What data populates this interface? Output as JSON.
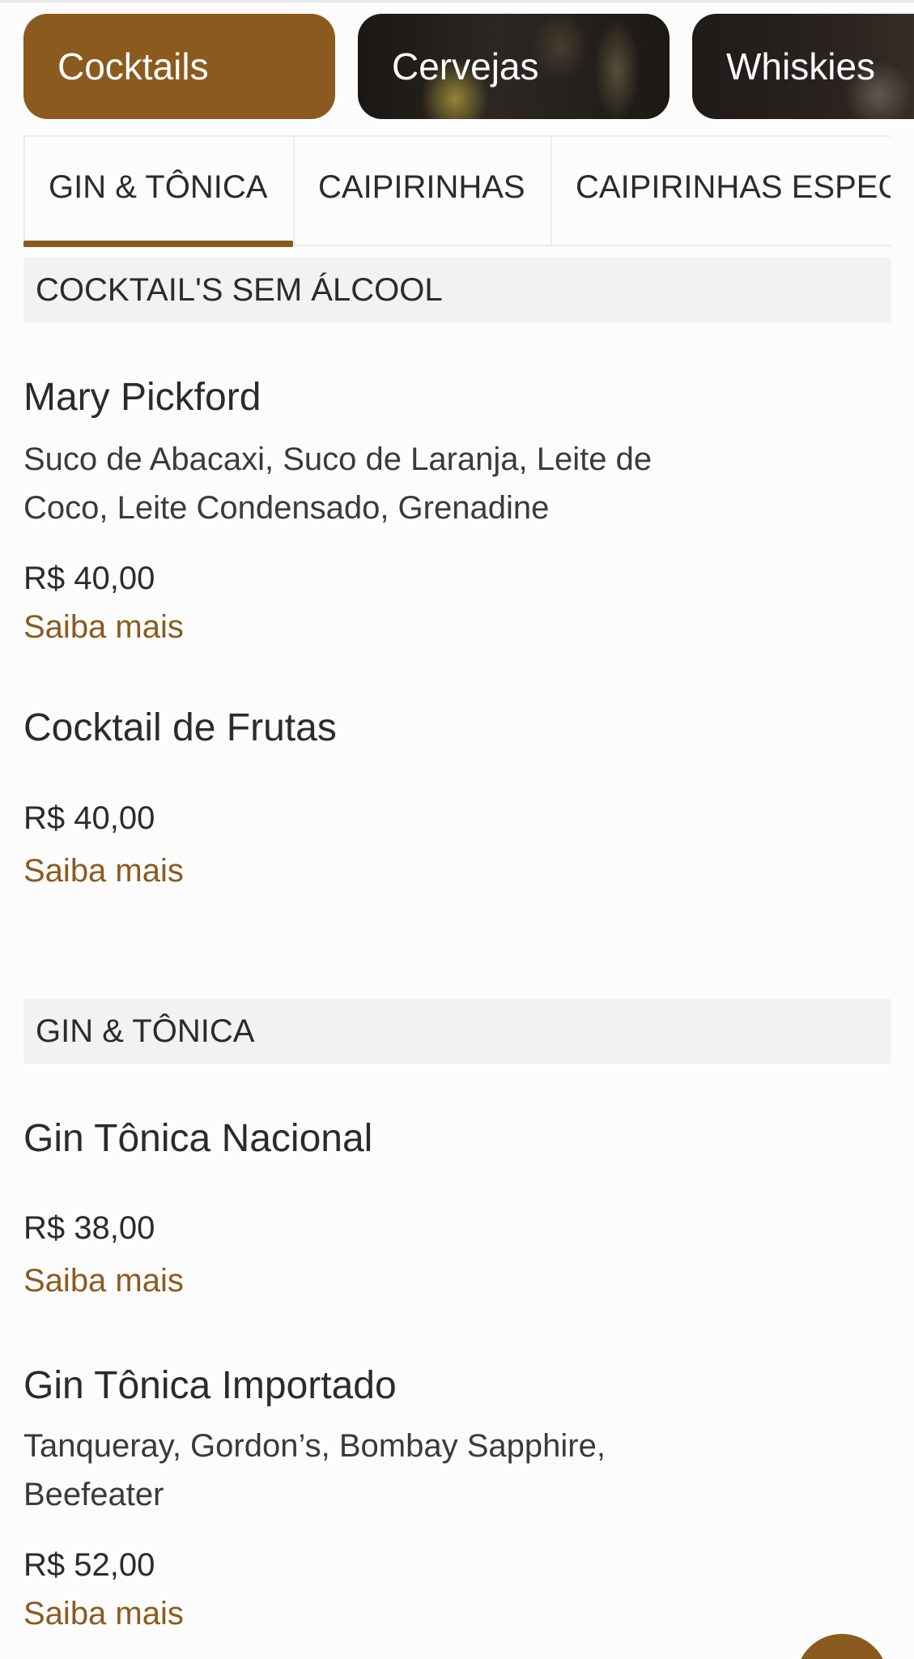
{
  "categories": [
    {
      "label": "Cocktails",
      "active": true
    },
    {
      "label": "Cervejas",
      "active": false
    },
    {
      "label": "Whiskies",
      "active": false
    }
  ],
  "tabs": [
    {
      "label": "GIN & TÔNICA",
      "active": true
    },
    {
      "label": "CAIPIRINHAS",
      "active": false
    },
    {
      "label": "CAIPIRINHAS ESPECI",
      "active": false
    }
  ],
  "sections": [
    {
      "title": "COCKTAIL'S SEM ÁLCOOL",
      "items": [
        {
          "name": "Mary Pickford",
          "description_lines": [
            "Suco de Abacaxi, Suco de Laranja, Leite de",
            "Coco, Leite Condensado, Grenadine"
          ],
          "price": "R$ 40,00",
          "more": "Saiba mais"
        },
        {
          "name": "Cocktail de Frutas",
          "price": "R$ 40,00",
          "more": "Saiba mais"
        }
      ]
    },
    {
      "title": "GIN & TÔNICA",
      "items": [
        {
          "name": "Gin Tônica Nacional",
          "price": "R$ 38,00",
          "more": "Saiba mais"
        },
        {
          "name": "Gin Tônica Importado",
          "description_lines": [
            "Tanqueray, Gordon’s, Bombay Sapphire,",
            "Beefeater"
          ],
          "price": "R$ 52,00",
          "more": "Saiba mais"
        }
      ]
    }
  ],
  "colors": {
    "accent": "#8b5a1e",
    "section_bg": "#f2f2f2",
    "text": "#2b2b2b"
  }
}
